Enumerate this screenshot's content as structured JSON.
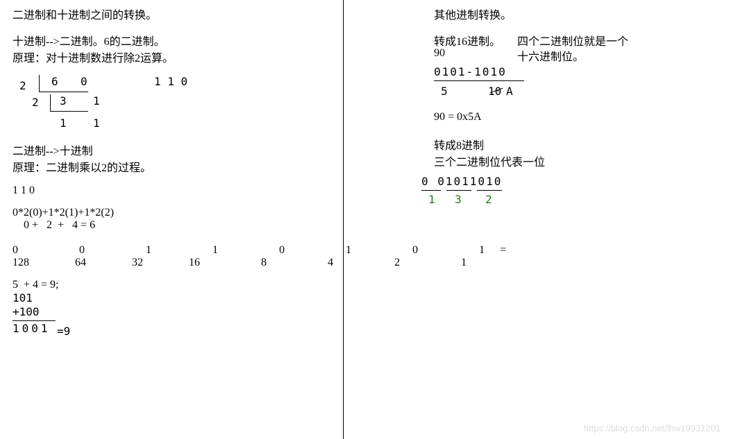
{
  "left": {
    "title": "二进制和十进制之间的转换。",
    "d2b_h1": "十进制-->二进制。6的二进制。",
    "d2b_h2": "原理：对十进制数进行除2运算。",
    "ladder": {
      "d0": "2",
      "q0": "6",
      "r0": "0",
      "d1": "2",
      "q1": "3",
      "r1": "1",
      "q2": "1",
      "r2": "1",
      "result": "1 1 0"
    },
    "b2d_h1": "二进制-->十进制",
    "b2d_h2": "原理：二进制乘以2的过程。",
    "b2d_bits": "1 1 0",
    "b2d_expr1": "0*2(0)+1*2(1)+1*2(2)",
    "b2d_expr2": "    0 +   2  +   4 = 6",
    "tbl_bits": "0    0    1    1    0    1    0    1 =",
    "tbl_vals": "128   64   32   16    8    4    2    1",
    "sum_line": "5  + 4 = 9;",
    "add": {
      "a": " 101",
      "b": "+100",
      "s": "1001",
      "eq": "=9"
    }
  },
  "right": {
    "title": "其他进制转换。",
    "hex_h1": "转成16进制。",
    "hex_h2a": "四个二进制位就是一个",
    "hex_h2b": "十六进制位。",
    "hex_num": "90",
    "hex_bits": "0101-1010",
    "hex_a": "5",
    "hex_b_strike": "10",
    "hex_b": "A",
    "hex_eq": "90 = 0x5A",
    "oct_h1": "转成8进制",
    "oct_h2": "三个二进制位代表一位",
    "oct_bits": "0 01011010",
    "oct_d1": "1",
    "oct_d2": "3",
    "oct_d3": "2"
  },
  "watermark": "https://blog.csdn.net/lhw19931201"
}
